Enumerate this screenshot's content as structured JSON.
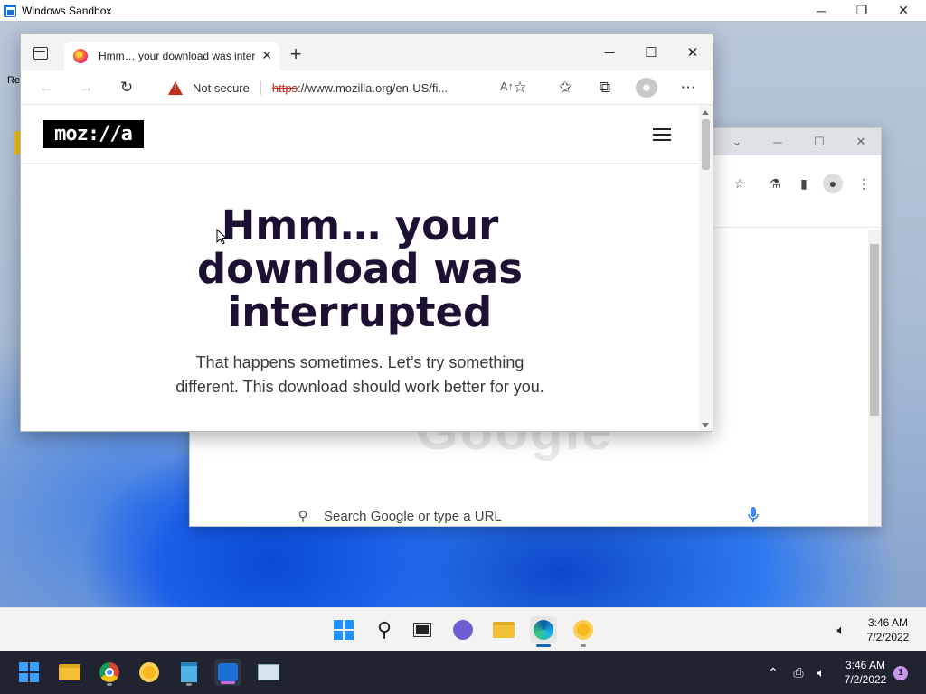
{
  "host": {
    "title": "Windows Sandbox",
    "controls": {
      "minimize": "─",
      "maximize": "❐",
      "close": "✕"
    }
  },
  "desktop": {
    "icon_label": "Re"
  },
  "chrome_window": {
    "search_placeholder": "Search Google or type a URL",
    "logo_ghost": "Google"
  },
  "edge": {
    "tab": {
      "title": "Hmm… your download was inter",
      "favicon": "firefox-icon"
    },
    "new_tab": "+",
    "controls": {
      "minimize": "─",
      "maximize": "☐",
      "close": "✕"
    },
    "address": {
      "security_label": "Not secure",
      "protocol": "https",
      "url_rest": "://www.mozilla.org/en-US/fi..."
    },
    "page": {
      "logo": "moz://a",
      "heading": "Hmm… your download was interrupted",
      "subtext": "That happens sometimes. Let’s try something different. This download should work better for you."
    }
  },
  "inner_taskbar": {
    "apps": [
      "start-icon",
      "search-icon",
      "task-view-icon",
      "chat-icon",
      "file-explorer-icon",
      "edge-icon",
      "chrome-canary-icon"
    ],
    "time": "3:46 AM",
    "date": "7/2/2022"
  },
  "host_taskbar": {
    "apps": [
      "start-icon",
      "file-explorer-icon",
      "chrome-icon",
      "chrome-canary-icon",
      "notepad-icon",
      "windows-sandbox-icon",
      "resource-monitor-icon"
    ],
    "time": "3:46 AM",
    "date": "7/2/2022",
    "notification_count": "1"
  }
}
